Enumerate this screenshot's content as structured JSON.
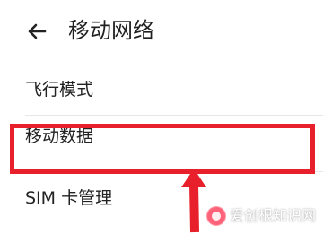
{
  "header": {
    "back_icon": "back-arrow-icon",
    "title": "移动网络"
  },
  "settings": {
    "items": [
      {
        "label": "飞行模式"
      },
      {
        "label": "移动数据"
      },
      {
        "label": "SIM 卡管理"
      }
    ]
  },
  "annotation": {
    "highlight_color": "#e8202b",
    "arrow_color": "#e8202b"
  },
  "watermark": {
    "brand": "爱创根",
    "suffix": "知识网"
  }
}
